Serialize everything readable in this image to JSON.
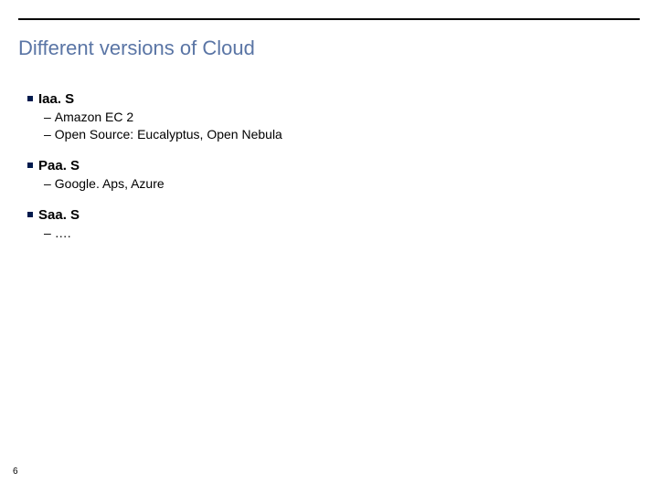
{
  "title": "Different versions of Cloud",
  "sections": [
    {
      "heading": "Iaa. S",
      "items": [
        "Amazon EC 2",
        "Open Source: Eucalyptus, Open Nebula"
      ]
    },
    {
      "heading": "Paa. S",
      "items": [
        "Google. Aps, Azure"
      ]
    },
    {
      "heading": "Saa. S",
      "items": [
        "…."
      ]
    }
  ],
  "page_number": "6"
}
